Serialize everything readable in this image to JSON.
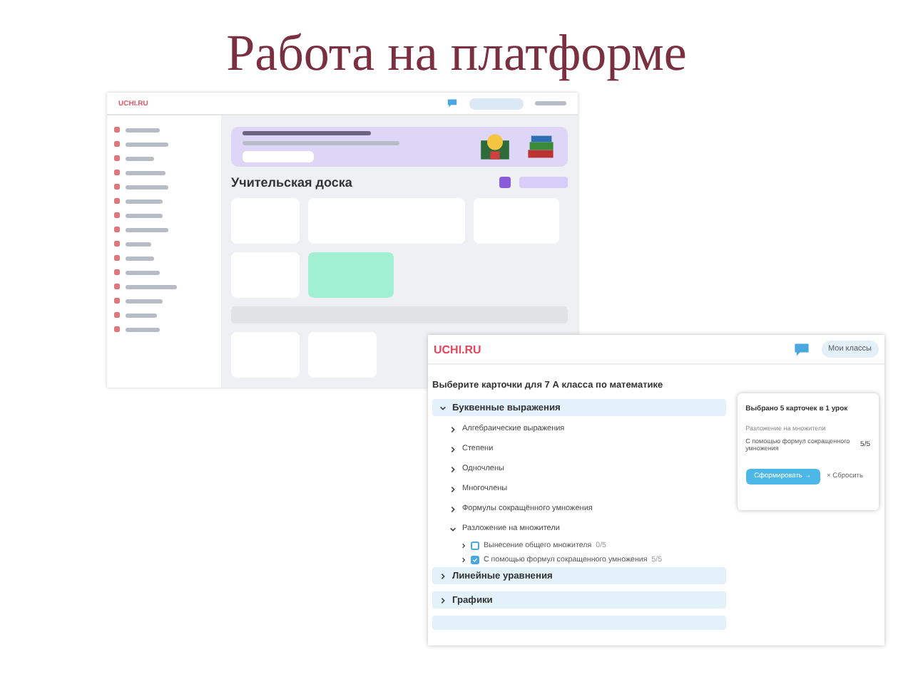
{
  "slide": {
    "title": "Работа на платформе"
  },
  "dashboard": {
    "logo": "UCHI.RU",
    "heading": "Учительская доска"
  },
  "cards_window": {
    "logo": "UCHI.RU",
    "classes_button": "Мои классы",
    "heading": "Выберите карточки для 7 А класса по математике",
    "topics": [
      {
        "label": "Буквенные выражения",
        "expanded": true,
        "children": [
          {
            "label": "Алгебраические выражения",
            "expanded": false
          },
          {
            "label": "Степени",
            "expanded": false
          },
          {
            "label": "Одночлены",
            "expanded": false
          },
          {
            "label": "Многочлены",
            "expanded": false
          },
          {
            "label": "Формулы сокращённого умножения",
            "expanded": false
          },
          {
            "label": "Разложение на множители",
            "expanded": true,
            "children": [
              {
                "label": "Вынесение общего множителя",
                "count": "0/5",
                "checked": false
              },
              {
                "label": "С помощью формул сокращенного умножения",
                "count": "5/5",
                "checked": true
              }
            ]
          }
        ]
      },
      {
        "label": "Линейные уравнения",
        "expanded": false
      },
      {
        "label": "Графики",
        "expanded": false
      }
    ],
    "summary": {
      "title": "Выбрано 5 карточек в 1 урок",
      "group": "Разложение на множители",
      "item": "С помощью формул сокращенного умножения",
      "count": "5/5",
      "submit_button": "Сформировать →",
      "reset_button": "× Сбросить"
    }
  }
}
